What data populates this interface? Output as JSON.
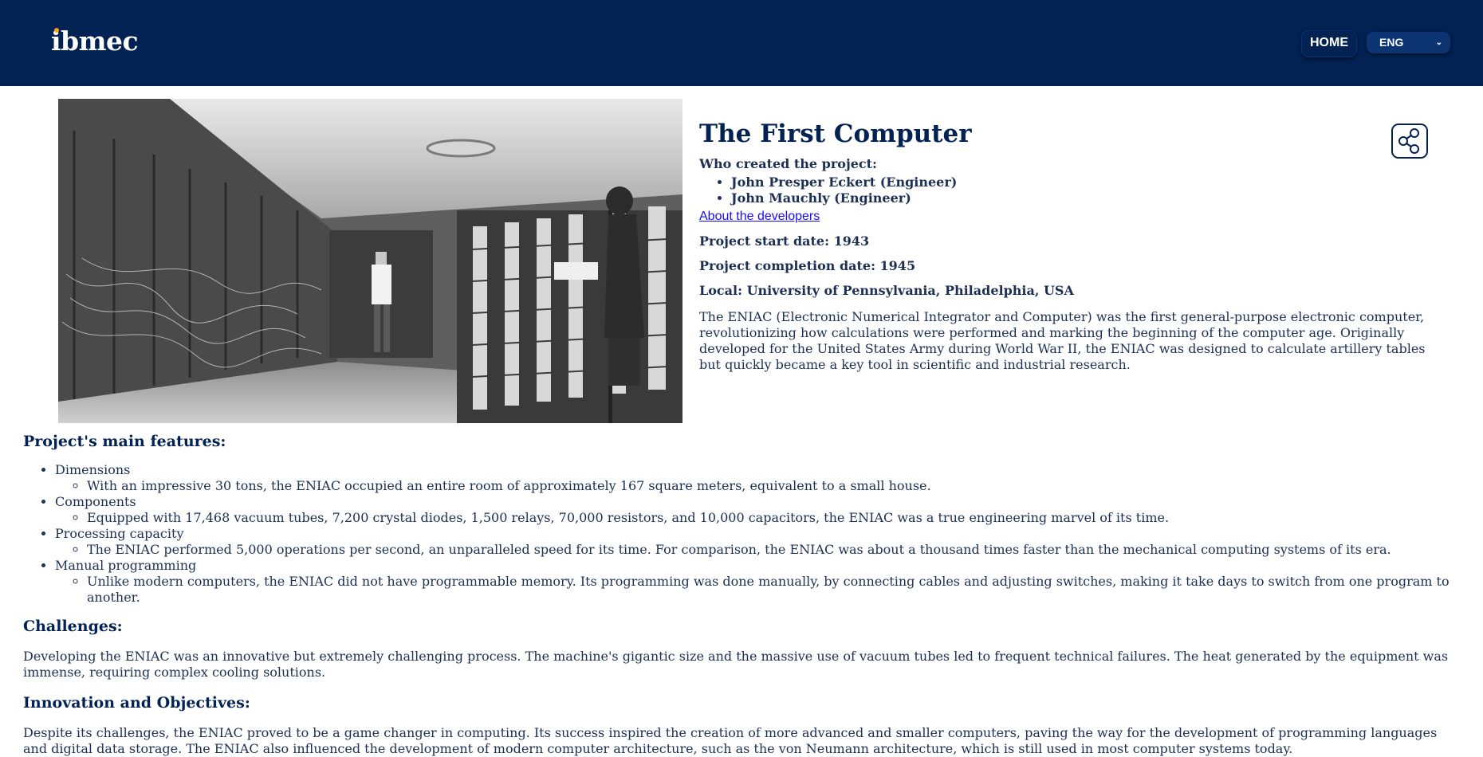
{
  "header": {
    "logo_text": "ibmec",
    "home_label": "HOME",
    "language_label": "ENG",
    "chevron_icon": "chevron-down-icon"
  },
  "hero": {
    "image_alt": "ENIAC computer room photo",
    "title": "The First Computer",
    "creator_label": "Who created the project:",
    "creators": [
      "John Presper Eckert (Engineer)",
      "John Mauchly (Engineer)"
    ],
    "about_link": "About the developers",
    "start_date": "Project start date: 1943",
    "completion_date": "Project completion date: 1945",
    "location": "Local: University of Pennsylvania, Philadelphia, USA",
    "intro": "The ENIAC (Electronic Numerical Integrator and Computer) was the first general-purpose electronic computer, revolutionizing how calculations were performed and marking the beginning of the computer age. Originally developed for the United States Army during World War II, the ENIAC was designed to calculate artillery tables but quickly became a key tool in scientific and industrial research.",
    "share_icon": "share-icon"
  },
  "features": {
    "heading": "Project's main features:",
    "items": [
      {
        "title": "Dimensions",
        "detail": "With an impressive 30 tons, the ENIAC occupied an entire room of approximately 167 square meters, equivalent to a small house."
      },
      {
        "title": "Components",
        "detail": "Equipped with 17,468 vacuum tubes, 7,200 crystal diodes, 1,500 relays, 70,000 resistors, and 10,000 capacitors, the ENIAC was a true engineering marvel of its time."
      },
      {
        "title": "Processing capacity",
        "detail": "The ENIAC performed 5,000 operations per second, an unparalleled speed for its time. For comparison, the ENIAC was about a thousand times faster than the mechanical computing systems of its era."
      },
      {
        "title": "Manual programming",
        "detail": "Unlike modern computers, the ENIAC did not have programmable memory. Its programming was done manually, by connecting cables and adjusting switches, making it take days to switch from one program to another."
      }
    ]
  },
  "challenges": {
    "heading": "Challenges:",
    "text": "Developing the ENIAC was an innovative but extremely challenging process. The machine's gigantic size and the massive use of vacuum tubes led to frequent technical failures. The heat generated by the equipment was immense, requiring complex cooling solutions."
  },
  "innovation": {
    "heading": "Innovation and Objectives:",
    "text": "Despite its challenges, the ENIAC proved to be a game changer in computing. Its success inspired the creation of more advanced and smaller computers, paving the way for the development of programming languages and digital data storage. The ENIAC also influenced the development of modern computer architecture, such as the von Neumann architecture, which is still used in most computer systems today."
  }
}
